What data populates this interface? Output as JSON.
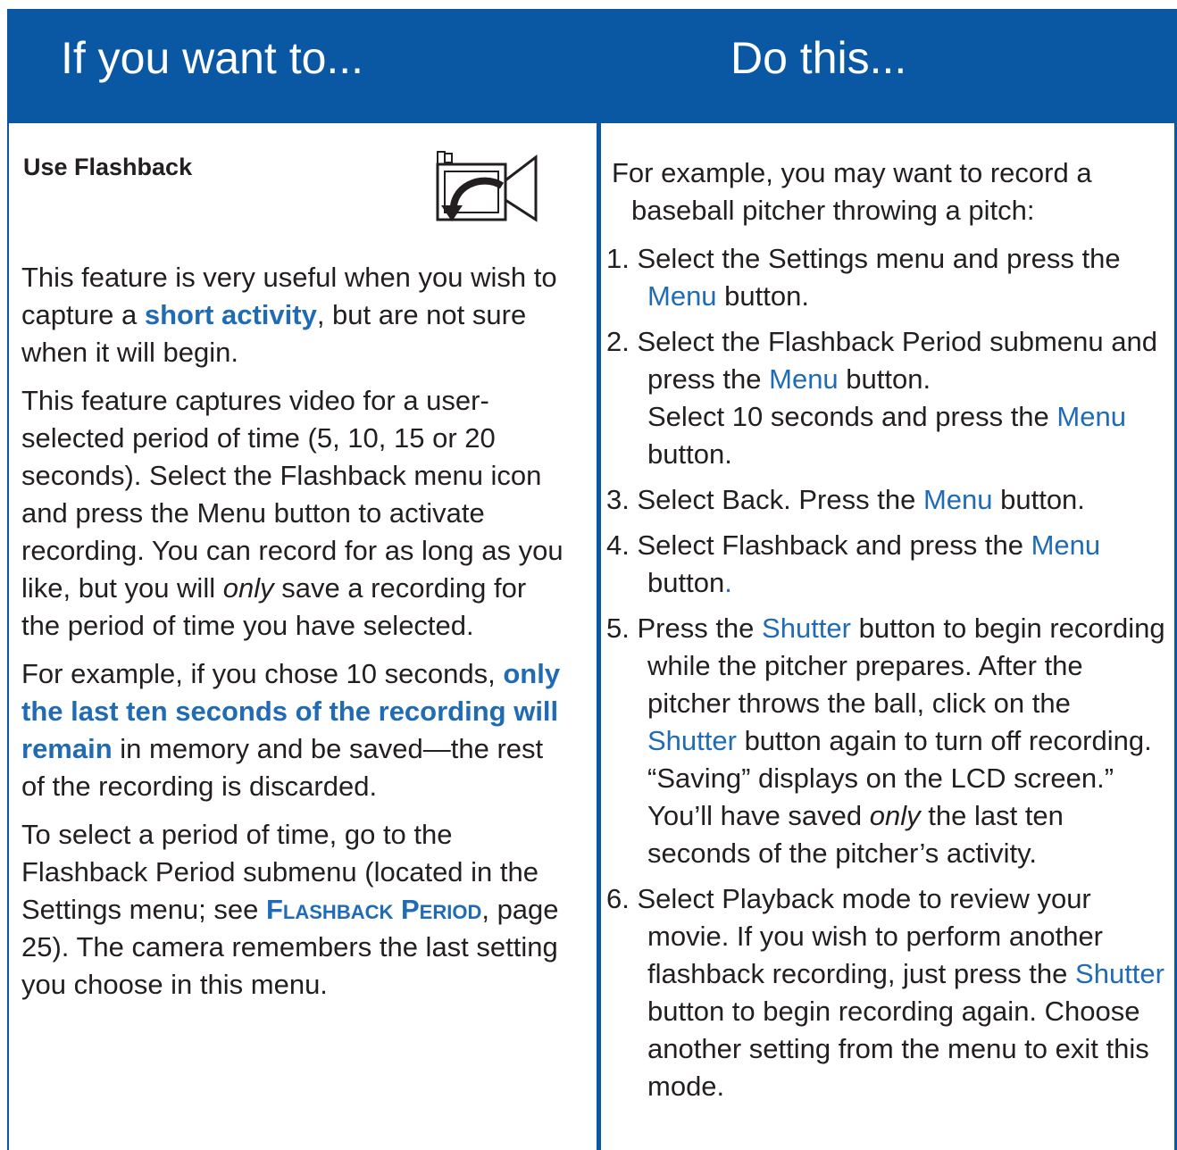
{
  "header": {
    "left_title": "If you want to...",
    "right_title": "Do this..."
  },
  "left": {
    "title": "Use Flashback",
    "p1": {
      "a": "This feature is very useful when you wish to capture a ",
      "b": "short activity",
      "c": ", but are not sure when it will begin."
    },
    "p2": {
      "a": "This feature captures video for a user-selected period of time (5, 10, 15 or 20 seconds). Select the Flashback menu icon and press the Menu button to activate recording. You can record for as long as you like, but you will ",
      "b": "only",
      "c": " save a recording for the period of time you have selected."
    },
    "p3": {
      "a": "For example, if you chose 10 seconds, ",
      "b": "only the last ten seconds of the recording will remain",
      "c": " in memory and be saved—the rest of the recording is discarded."
    },
    "p4": {
      "a": "To select a period of time, go to the Flashback Period submenu (located in the Settings menu; see ",
      "b": "Flashback Period",
      "c": ", page 25). The camera remembers the last setting you choose in this menu."
    }
  },
  "right": {
    "intro": "For example, you may want to record a baseball pitcher throwing a pitch:",
    "steps": [
      {
        "num": "1. ",
        "a": "Select the Settings menu and press the ",
        "b": "Menu",
        "c": " button."
      },
      {
        "num": "2. ",
        "a": "Select the Flashback Period submenu and press the ",
        "b": "Menu",
        "c": " button.",
        "d": "Select 10 seconds and press the ",
        "e": "Menu",
        "f": " button."
      },
      {
        "num": "3. ",
        "a": "Select Back. Press the ",
        "b": "Menu",
        "c": " button."
      },
      {
        "num": "4. ",
        "a": "Select Flashback and press the ",
        "b": "Menu",
        "c": " button",
        "d": "."
      },
      {
        "num": "5. ",
        "a": "Press the ",
        "b": "Shutter",
        "c": " button to begin recording while the pitcher prepares. After the pitcher throws the ball, click on the ",
        "d": "Shutter",
        "e": " button again to turn off recording. “Saving” displays on the LCD screen.” You’ll have saved ",
        "f": "only",
        "g": " the last ten seconds of the pitcher’s activity."
      },
      {
        "num": "6. ",
        "a": "Select Playback mode to review your movie. If you wish to perform another flashback recording, just press the ",
        "b": "Shutter",
        "c": " button to begin recording again. Choose another setting from the menu to exit this mode."
      }
    ]
  },
  "icons": {
    "flashback": "flashback-camera-icon"
  },
  "colors": {
    "header_bg": "#0a58a3",
    "accent": "#1f6bb5",
    "text": "#231f20"
  }
}
